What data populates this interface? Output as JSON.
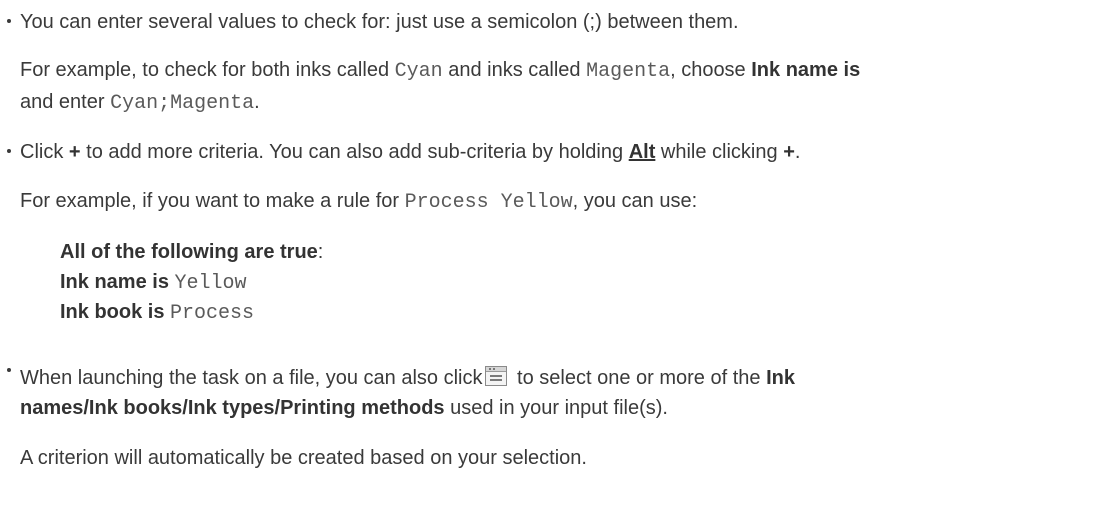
{
  "bullet1": {
    "text": "You can enter several values to check for: just use a semicolon (;) between them.",
    "example_prefix": "For example, to check for both inks called ",
    "code_cyan": "Cyan",
    "and_inks": " and inks called ",
    "code_magenta": "Magenta",
    "choose": ", choose ",
    "ink_name_is": "Ink name is",
    "and_enter": "and enter ",
    "code_cyan_magenta": "Cyan;Magenta",
    "period": "."
  },
  "bullet2": {
    "click": "Click ",
    "plus": "+",
    "add_more": " to add more criteria. You can also add sub-criteria by holding ",
    "alt": "Alt",
    "while_clicking": " while clicking ",
    "plus2": "+",
    "period": ".",
    "example_prefix": "For example, if you want to make a rule for ",
    "code_process_yellow": "Process Yellow",
    "can_use": ", you can use:",
    "rule_all": "All of the following are true",
    "colon": ":",
    "rule_ink_name": "Ink name is",
    "rule_yellow": "Yellow",
    "rule_ink_book": "Ink book is",
    "rule_process": "Process"
  },
  "bullet3": {
    "launching": "When launching the task on a file, you can also click",
    "to_select": " to select one or more of the ",
    "ink_names": "Ink",
    "names_line2": "names/Ink books/Ink types/Printing methods",
    "used_in": " used in your input file(s).",
    "criterion": "A criterion will automatically be created based on your selection.",
    "icon": "list-window-icon"
  }
}
